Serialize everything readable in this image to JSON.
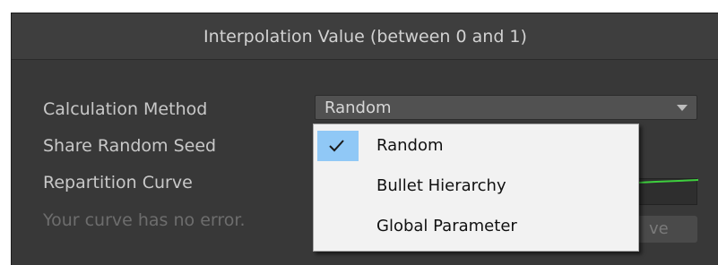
{
  "panel": {
    "header_title": "Interpolation Value (between 0 and 1)"
  },
  "fields": {
    "calculation_method_label": "Calculation Method",
    "share_random_seed_label": "Share Random Seed",
    "repartition_curve_label": "Repartition Curve",
    "curve_status_text": "Your curve has no error."
  },
  "dropdown": {
    "selected_value": "Random"
  },
  "hidden_button": {
    "partial_label": "ve"
  },
  "menu": {
    "items": [
      {
        "label": "Random",
        "checked": true
      },
      {
        "label": "Bullet Hierarchy",
        "checked": false
      },
      {
        "label": "Global Parameter",
        "checked": false
      }
    ]
  },
  "colors": {
    "panel_bg": "#383838",
    "header_bg": "#3e3e3e",
    "menu_bg": "#f2f2f2",
    "selection_highlight": "#90c8f6",
    "curve_line": "#3ecf3e"
  },
  "icons": {
    "check": "check-icon",
    "dropdown_arrow": "dropdown-arrow-icon"
  }
}
